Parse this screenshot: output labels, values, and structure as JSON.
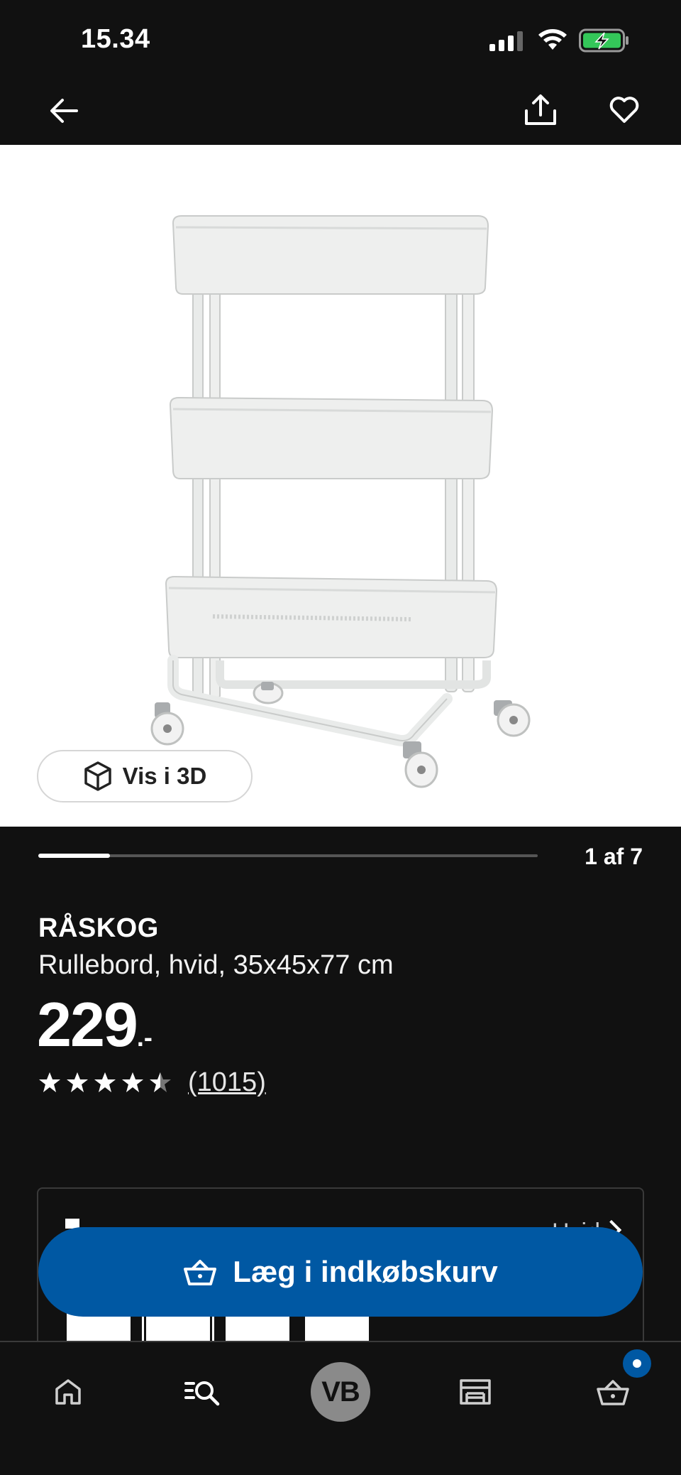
{
  "status_bar": {
    "time": "15.34",
    "icons": [
      "cellular-signal-icon",
      "wifi-icon",
      "battery-charging-icon"
    ]
  },
  "nav": {
    "back_icon": "arrow-left-icon",
    "share_icon": "share-icon",
    "favorite_icon": "heart-icon"
  },
  "gallery": {
    "image_alt": "RÅSKOG rullebord",
    "view_3d_label": "Vis i 3D",
    "view_3d_icon": "cube-icon",
    "page_counter": "1 af 7",
    "current_index": 1,
    "total_images": 7
  },
  "product": {
    "name": "RÅSKOG",
    "description": "Rullebord, hvid, 35x45x77 cm",
    "price": "229",
    "price_suffix": ".-",
    "rating": 4.5,
    "rating_max": 5,
    "review_count": "(1015)"
  },
  "variants": {
    "title": "F",
    "link_label": "Hvid",
    "swatches": [
      "variant-1",
      "variant-2",
      "variant-3",
      "variant-4"
    ],
    "selected_index": 1
  },
  "cart_button": {
    "label": "Læg i indkøbskurv",
    "icon": "basket-icon"
  },
  "tab_bar": {
    "items": [
      {
        "name": "home",
        "icon": "home-icon"
      },
      {
        "name": "search",
        "icon": "search-list-icon"
      },
      {
        "name": "profile",
        "avatar_initials": "VB"
      },
      {
        "name": "stores",
        "icon": "store-icon"
      },
      {
        "name": "cart",
        "icon": "basket-icon",
        "has_badge": true
      }
    ]
  },
  "colors": {
    "background": "#111111",
    "accent": "#0058a3",
    "image_background": "#ffffff"
  }
}
